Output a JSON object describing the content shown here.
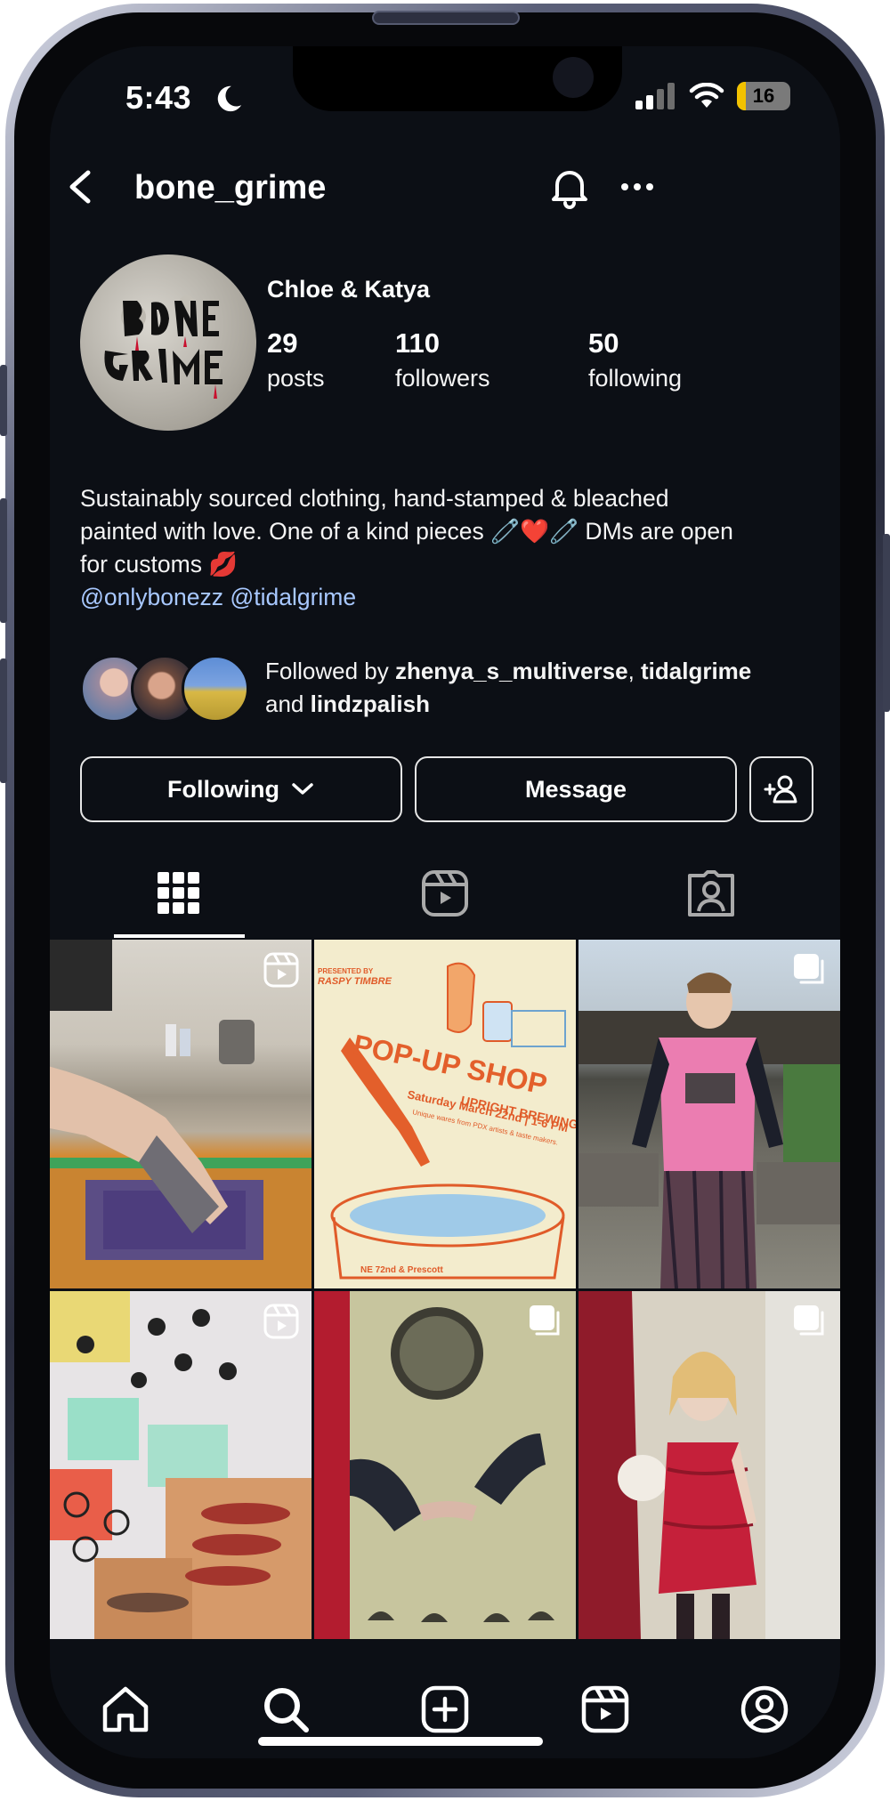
{
  "status_bar": {
    "time": "5:43",
    "battery": "16"
  },
  "header": {
    "username": "bone_grime"
  },
  "profile": {
    "avatar_text": "BONE GRIME",
    "display_name": "Chloe & Katya",
    "stats": {
      "posts": {
        "value": "29",
        "label": "posts"
      },
      "followers": {
        "value": "110",
        "label": "followers"
      },
      "following": {
        "value": "50",
        "label": "following"
      }
    },
    "bio_line1": "Sustainably sourced clothing, hand-stamped & bleached",
    "bio_line2": "painted with love. One of a kind pieces 🧷❤️🧷 DMs are open",
    "bio_line3": "for customs 💋",
    "bio_link1": "@onlybonezz",
    "bio_link2": "@tidalgrime"
  },
  "followed_by": {
    "prefix": "Followed by ",
    "user1": "zhenya_s_multiverse",
    "sep": ", ",
    "user2": "tidalgrime",
    "and": "and ",
    "user3": "lindzpalish"
  },
  "buttons": {
    "following": "Following",
    "message": "Message"
  },
  "posts": [
    {
      "kind": "reel",
      "desc": "screen printing"
    },
    {
      "kind": "reel-free",
      "poster_presented": "PRESENTED BY",
      "poster_brand": "RASPY TIMBRE",
      "poster_brewing": "UPRIGHT BREWING",
      "poster_title": "POP-UP SHOP",
      "poster_date": "Saturday March 22nd | 1-6 PM",
      "poster_sub": "Unique wares from PDX artists & taste makers.",
      "poster_addr": "NE 72nd & Prescott"
    },
    {
      "kind": "carousel"
    },
    {
      "kind": "reel"
    },
    {
      "kind": "carousel"
    },
    {
      "kind": "carousel"
    }
  ],
  "colors": {
    "background": "#0c0f15",
    "link": "#a8c8ff",
    "text": "#f5f5f5",
    "battery_fill": "#f2c200"
  }
}
